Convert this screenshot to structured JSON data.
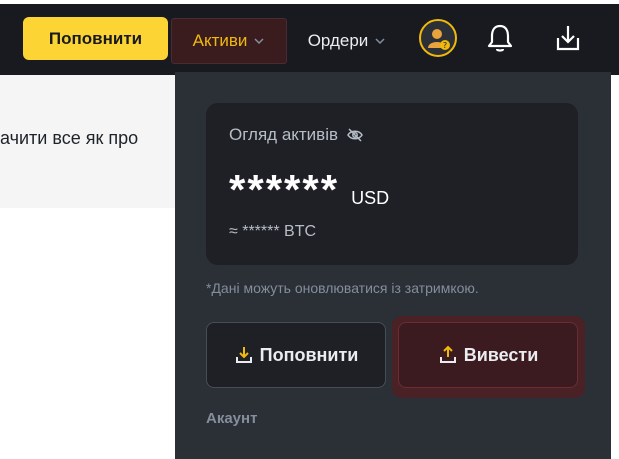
{
  "header": {
    "deposit_label": "Поповнити",
    "assets_label": "Активи",
    "orders_label": "Ордери"
  },
  "background": {
    "banner_text": "ачити все як про"
  },
  "assets_dropdown": {
    "overview_title": "Огляд активів",
    "balance_value": "******",
    "balance_currency": "USD",
    "btc_equivalent": "≈ ****** BTC",
    "delay_note": "*Дані можуть оновлюватися із затримкою.",
    "deposit_label": "Поповнити",
    "withdraw_label": "Вивести",
    "account_section_label": "Акаунт"
  },
  "icons": {
    "assets_chevron": "chevron-down-icon",
    "orders_chevron": "chevron-down-icon",
    "avatar": "user-avatar-icon",
    "bell": "bell-icon",
    "download": "download-icon",
    "hide_balance": "eye-slash-icon",
    "deposit": "deposit-icon",
    "withdraw": "withdraw-icon"
  },
  "colors": {
    "brand_yellow": "#fcd535",
    "accent_gold": "#f0b90b",
    "topbar_bg": "#181a20",
    "dropdown_bg": "#2b2f36",
    "card_bg": "#1e2026",
    "withdraw_bg": "#3b1b1f"
  }
}
